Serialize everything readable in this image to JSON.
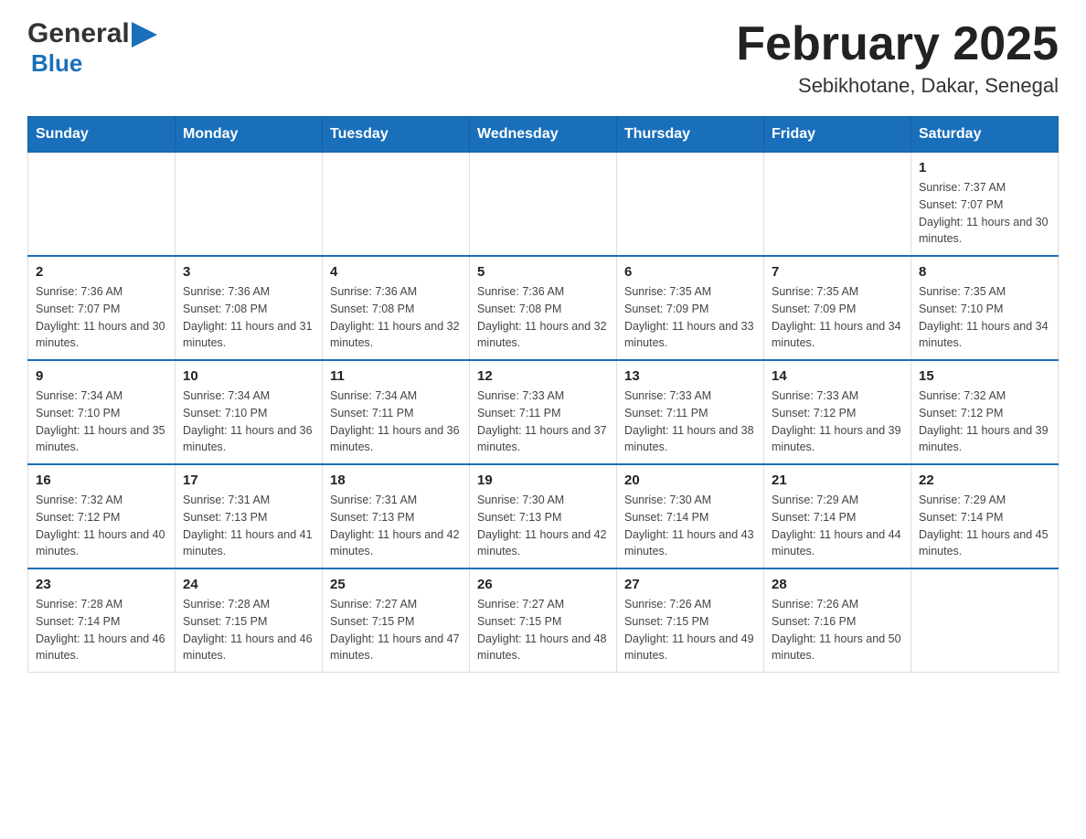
{
  "header": {
    "logo_general": "General",
    "logo_blue": "Blue",
    "title": "February 2025",
    "subtitle": "Sebikhotane, Dakar, Senegal"
  },
  "days_of_week": [
    "Sunday",
    "Monday",
    "Tuesday",
    "Wednesday",
    "Thursday",
    "Friday",
    "Saturday"
  ],
  "weeks": [
    [
      {
        "day": "",
        "info": ""
      },
      {
        "day": "",
        "info": ""
      },
      {
        "day": "",
        "info": ""
      },
      {
        "day": "",
        "info": ""
      },
      {
        "day": "",
        "info": ""
      },
      {
        "day": "",
        "info": ""
      },
      {
        "day": "1",
        "info": "Sunrise: 7:37 AM\nSunset: 7:07 PM\nDaylight: 11 hours and 30 minutes."
      }
    ],
    [
      {
        "day": "2",
        "info": "Sunrise: 7:36 AM\nSunset: 7:07 PM\nDaylight: 11 hours and 30 minutes."
      },
      {
        "day": "3",
        "info": "Sunrise: 7:36 AM\nSunset: 7:08 PM\nDaylight: 11 hours and 31 minutes."
      },
      {
        "day": "4",
        "info": "Sunrise: 7:36 AM\nSunset: 7:08 PM\nDaylight: 11 hours and 32 minutes."
      },
      {
        "day": "5",
        "info": "Sunrise: 7:36 AM\nSunset: 7:08 PM\nDaylight: 11 hours and 32 minutes."
      },
      {
        "day": "6",
        "info": "Sunrise: 7:35 AM\nSunset: 7:09 PM\nDaylight: 11 hours and 33 minutes."
      },
      {
        "day": "7",
        "info": "Sunrise: 7:35 AM\nSunset: 7:09 PM\nDaylight: 11 hours and 34 minutes."
      },
      {
        "day": "8",
        "info": "Sunrise: 7:35 AM\nSunset: 7:10 PM\nDaylight: 11 hours and 34 minutes."
      }
    ],
    [
      {
        "day": "9",
        "info": "Sunrise: 7:34 AM\nSunset: 7:10 PM\nDaylight: 11 hours and 35 minutes."
      },
      {
        "day": "10",
        "info": "Sunrise: 7:34 AM\nSunset: 7:10 PM\nDaylight: 11 hours and 36 minutes."
      },
      {
        "day": "11",
        "info": "Sunrise: 7:34 AM\nSunset: 7:11 PM\nDaylight: 11 hours and 36 minutes."
      },
      {
        "day": "12",
        "info": "Sunrise: 7:33 AM\nSunset: 7:11 PM\nDaylight: 11 hours and 37 minutes."
      },
      {
        "day": "13",
        "info": "Sunrise: 7:33 AM\nSunset: 7:11 PM\nDaylight: 11 hours and 38 minutes."
      },
      {
        "day": "14",
        "info": "Sunrise: 7:33 AM\nSunset: 7:12 PM\nDaylight: 11 hours and 39 minutes."
      },
      {
        "day": "15",
        "info": "Sunrise: 7:32 AM\nSunset: 7:12 PM\nDaylight: 11 hours and 39 minutes."
      }
    ],
    [
      {
        "day": "16",
        "info": "Sunrise: 7:32 AM\nSunset: 7:12 PM\nDaylight: 11 hours and 40 minutes."
      },
      {
        "day": "17",
        "info": "Sunrise: 7:31 AM\nSunset: 7:13 PM\nDaylight: 11 hours and 41 minutes."
      },
      {
        "day": "18",
        "info": "Sunrise: 7:31 AM\nSunset: 7:13 PM\nDaylight: 11 hours and 42 minutes."
      },
      {
        "day": "19",
        "info": "Sunrise: 7:30 AM\nSunset: 7:13 PM\nDaylight: 11 hours and 42 minutes."
      },
      {
        "day": "20",
        "info": "Sunrise: 7:30 AM\nSunset: 7:14 PM\nDaylight: 11 hours and 43 minutes."
      },
      {
        "day": "21",
        "info": "Sunrise: 7:29 AM\nSunset: 7:14 PM\nDaylight: 11 hours and 44 minutes."
      },
      {
        "day": "22",
        "info": "Sunrise: 7:29 AM\nSunset: 7:14 PM\nDaylight: 11 hours and 45 minutes."
      }
    ],
    [
      {
        "day": "23",
        "info": "Sunrise: 7:28 AM\nSunset: 7:14 PM\nDaylight: 11 hours and 46 minutes."
      },
      {
        "day": "24",
        "info": "Sunrise: 7:28 AM\nSunset: 7:15 PM\nDaylight: 11 hours and 46 minutes."
      },
      {
        "day": "25",
        "info": "Sunrise: 7:27 AM\nSunset: 7:15 PM\nDaylight: 11 hours and 47 minutes."
      },
      {
        "day": "26",
        "info": "Sunrise: 7:27 AM\nSunset: 7:15 PM\nDaylight: 11 hours and 48 minutes."
      },
      {
        "day": "27",
        "info": "Sunrise: 7:26 AM\nSunset: 7:15 PM\nDaylight: 11 hours and 49 minutes."
      },
      {
        "day": "28",
        "info": "Sunrise: 7:26 AM\nSunset: 7:16 PM\nDaylight: 11 hours and 50 minutes."
      },
      {
        "day": "",
        "info": ""
      }
    ]
  ]
}
